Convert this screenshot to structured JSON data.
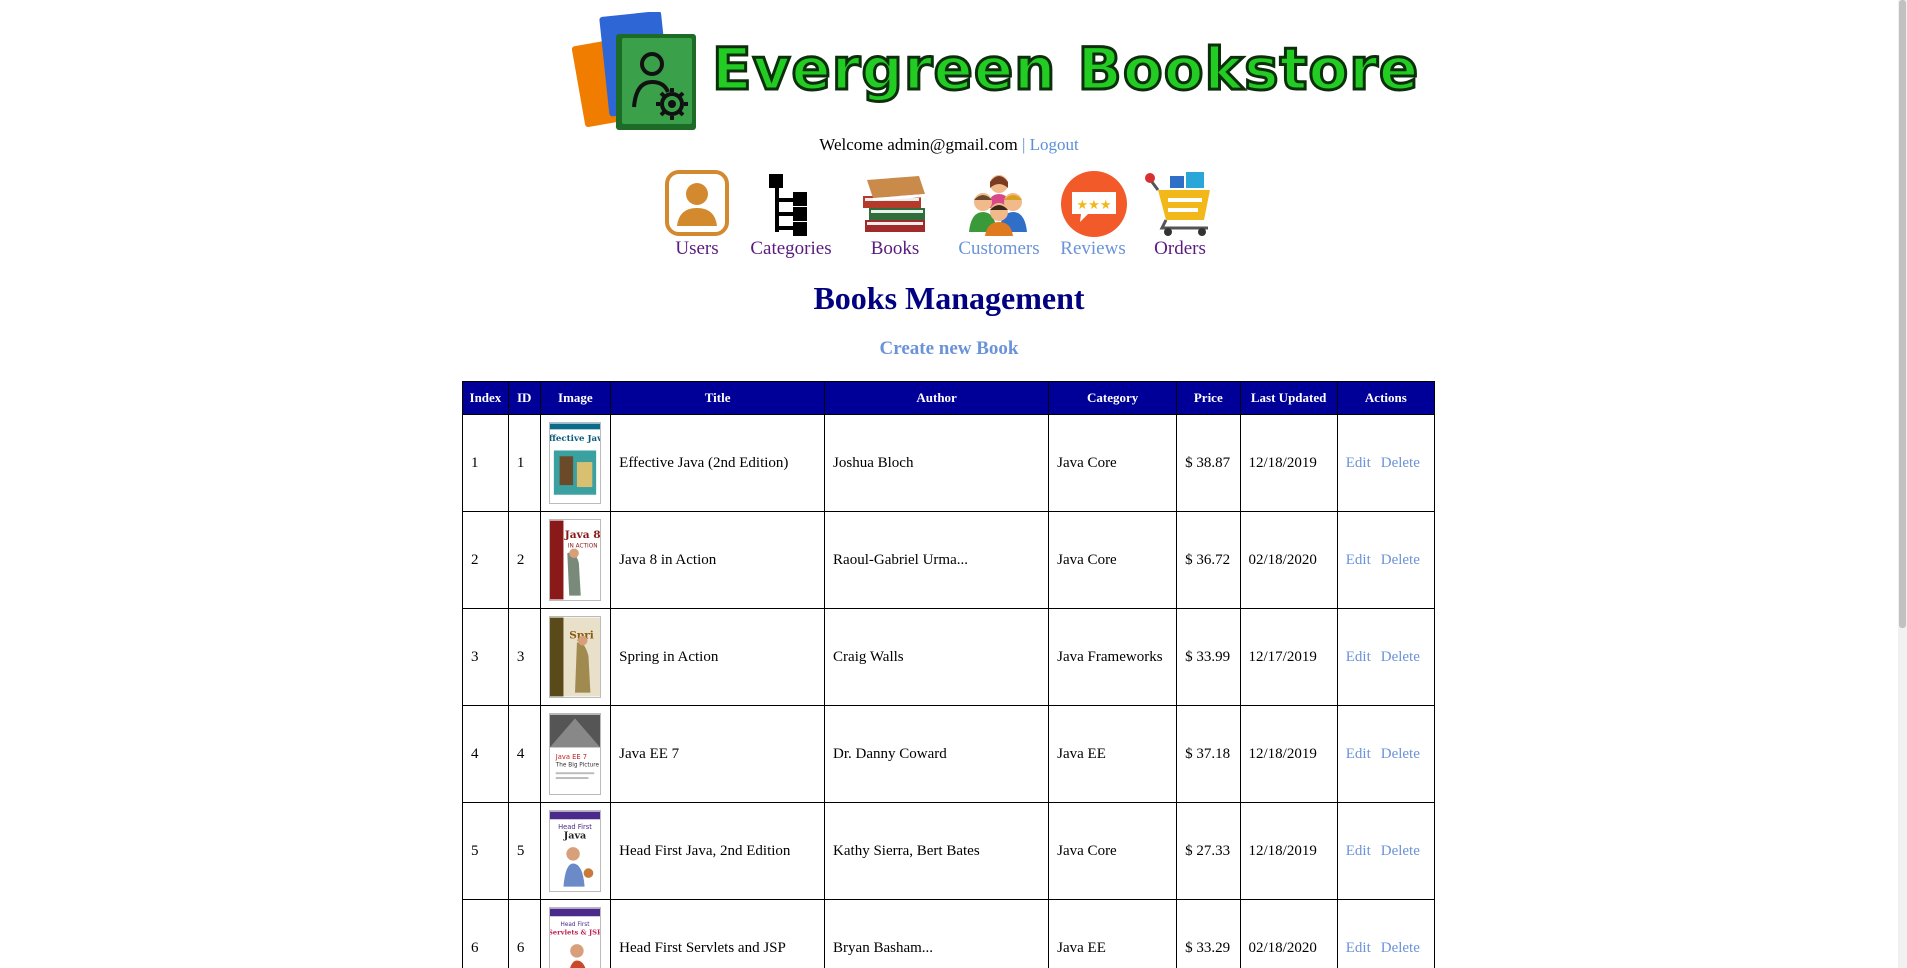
{
  "header": {
    "brand_name": "Evergreen Bookstore",
    "welcome_text": "Welcome admin@gmail.com",
    "separator": "|",
    "logout_label": "Logout"
  },
  "menu": {
    "users": "Users",
    "categories": "Categories",
    "books": "Books",
    "customers": "Customers",
    "reviews": "Reviews",
    "orders": "Orders"
  },
  "main": {
    "title": "Books Management",
    "create_label": "Create new Book"
  },
  "table": {
    "headers": [
      "Index",
      "ID",
      "Image",
      "Title",
      "Author",
      "Category",
      "Price",
      "Last Updated",
      "Actions"
    ],
    "rows": [
      {
        "index": "1",
        "id": "1",
        "title": "Effective Java (2nd Edition)",
        "author": "Joshua Bloch",
        "category": "Java Core",
        "price": "$ 38.87",
        "updated": "12/18/2019",
        "edit": "Edit",
        "delete": "Delete"
      },
      {
        "index": "2",
        "id": "2",
        "title": "Java 8 in Action",
        "author": "Raoul-Gabriel Urma...",
        "category": "Java Core",
        "price": "$ 36.72",
        "updated": "02/18/2020",
        "edit": "Edit",
        "delete": "Delete"
      },
      {
        "index": "3",
        "id": "3",
        "title": "Spring in Action",
        "author": "Craig Walls",
        "category": "Java Frameworks",
        "price": "$ 33.99",
        "updated": "12/17/2019",
        "edit": "Edit",
        "delete": "Delete"
      },
      {
        "index": "4",
        "id": "4",
        "title": "Java EE 7",
        "author": "Dr. Danny Coward",
        "category": "Java EE",
        "price": "$ 37.18",
        "updated": "12/18/2019",
        "edit": "Edit",
        "delete": "Delete"
      },
      {
        "index": "5",
        "id": "5",
        "title": "Head First Java, 2nd Edition",
        "author": "Kathy Sierra, Bert Bates",
        "category": "Java Core",
        "price": "$ 27.33",
        "updated": "12/18/2019",
        "edit": "Edit",
        "delete": "Delete"
      },
      {
        "index": "6",
        "id": "6",
        "title": "Head First Servlets and JSP",
        "author": "Bryan Basham...",
        "category": "Java EE",
        "price": "$ 33.29",
        "updated": "02/18/2020",
        "edit": "Edit",
        "delete": "Delete"
      }
    ]
  },
  "colors": {
    "header_bg": "#000099",
    "title_color": "#000080",
    "link_color": "#6a93d8",
    "visited_color": "#5a1a80",
    "brand_green": "#22cc22"
  },
  "icons": {
    "logo": "books-admin-gear-icon",
    "users": "user-avatar-icon",
    "categories": "tree-hierarchy-icon",
    "books": "book-stack-icon",
    "customers": "people-group-icon",
    "reviews": "star-rating-bubble-icon",
    "orders": "shopping-cart-icon"
  }
}
